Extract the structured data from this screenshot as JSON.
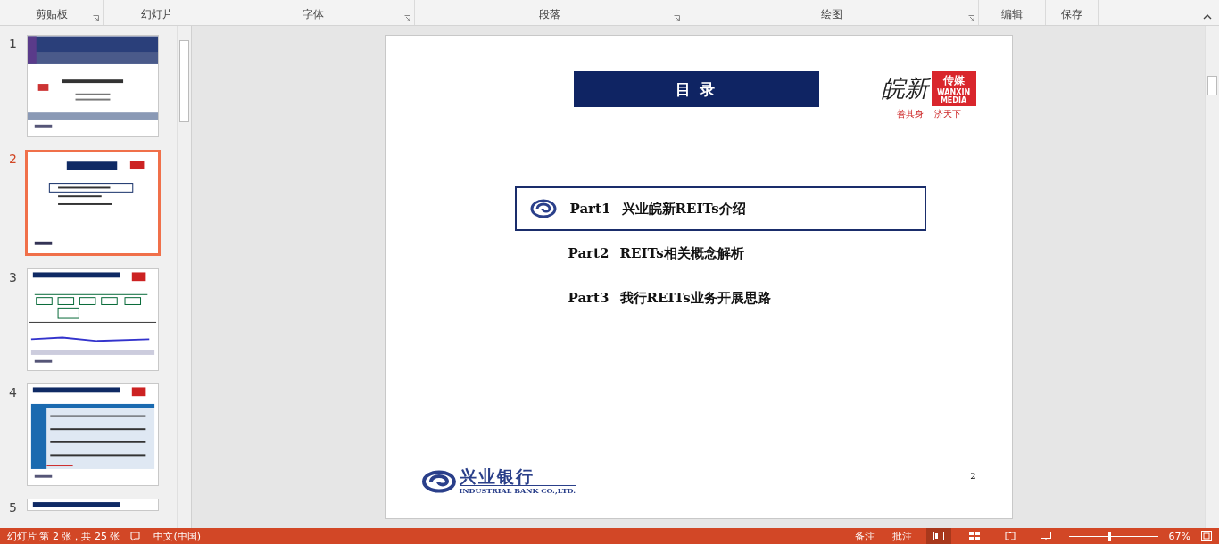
{
  "ribbon": {
    "groups": [
      {
        "label": "剪贴板",
        "launcher": true
      },
      {
        "label": "幻灯片",
        "launcher": false
      },
      {
        "label": "字体",
        "launcher": true
      },
      {
        "label": "段落",
        "launcher": true
      },
      {
        "label": "绘图",
        "launcher": true
      },
      {
        "label": "编辑",
        "launcher": false
      },
      {
        "label": "保存",
        "launcher": false
      }
    ]
  },
  "thumbnails": [
    {
      "number": "1",
      "selected": false,
      "kind": "cover"
    },
    {
      "number": "2",
      "selected": true,
      "kind": "contents"
    },
    {
      "number": "3",
      "selected": false,
      "kind": "flow"
    },
    {
      "number": "4",
      "selected": false,
      "kind": "table"
    },
    {
      "number": "5",
      "selected": false,
      "kind": "blank"
    }
  ],
  "slide": {
    "title": "目 录",
    "brand": {
      "name": "皖新",
      "tag_cn": "传媒",
      "tag_en": "WANXIN MEDIA",
      "slogan": [
        "善其身",
        "济天下"
      ]
    },
    "items": [
      {
        "part": "Part1",
        "text": "兴业皖新REITs介绍",
        "selected": true
      },
      {
        "part": "Part2",
        "text": "REITs相关概念解析",
        "selected": false
      },
      {
        "part": "Part3",
        "text": "我行REITs业务开展思路",
        "selected": false
      }
    ],
    "bank": {
      "name": "兴业银行",
      "name_en": "INDUSTRIAL BANK CO.,LTD."
    },
    "page_number": "2"
  },
  "status_bar": {
    "slide_info": "幻灯片 第 2 张，共 25 张",
    "language": "中文(中国)",
    "notes": "备注",
    "comments": "批注",
    "zoom": "67%",
    "zoom_slider": {
      "level": 0.46
    }
  }
}
